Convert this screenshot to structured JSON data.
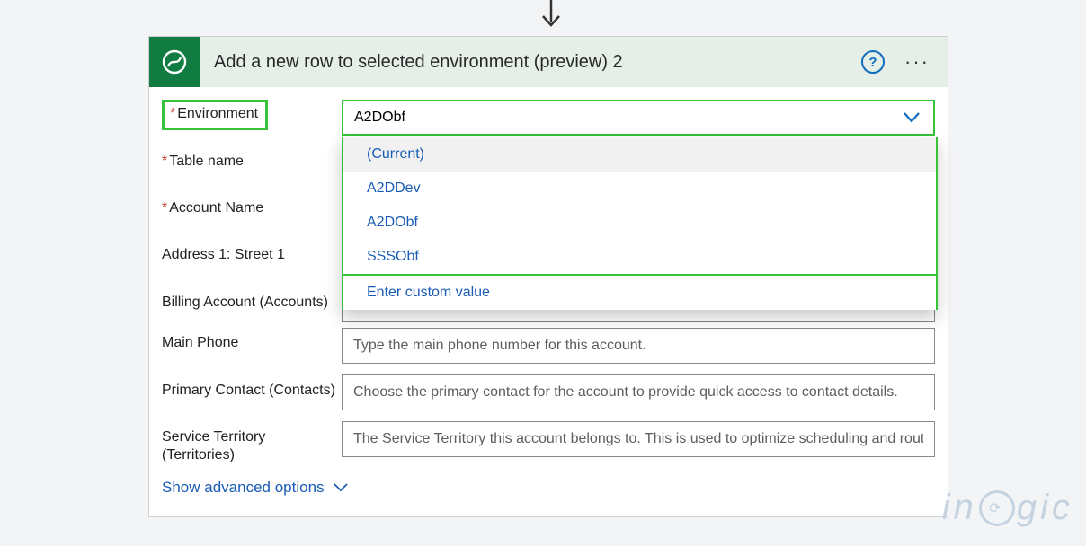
{
  "header": {
    "title": "Add a new row to selected environment (preview) 2",
    "icon": "dataverse-swirl-icon",
    "help": "?",
    "more": "···"
  },
  "fields": {
    "environment": {
      "label": "Environment",
      "value": "A2DObf",
      "required": true
    },
    "table_name": {
      "label": "Table name",
      "required": true
    },
    "account_name": {
      "label": "Account Name",
      "required": true
    },
    "address1_street1": {
      "label": "Address 1: Street 1"
    },
    "billing_account": {
      "label": "Billing Account (Accounts)"
    },
    "main_phone": {
      "label": "Main Phone",
      "placeholder": "Type the main phone number for this account."
    },
    "primary_contact": {
      "label": "Primary Contact (Contacts)",
      "placeholder": "Choose the primary contact for the account to provide quick access to contact details."
    },
    "service_territory": {
      "label": "Service Territory (Territories)",
      "placeholder": "The Service Territory this account belongs to. This is used to optimize scheduling and routing."
    }
  },
  "dropdown": {
    "options": [
      {
        "label": "(Current)",
        "selected": true
      },
      {
        "label": "A2DDev"
      },
      {
        "label": "A2DObf"
      },
      {
        "label": "SSSObf"
      }
    ],
    "custom_value_label": "Enter custom value"
  },
  "advanced_options_label": "Show advanced options",
  "watermark": {
    "prefix": "in",
    "suffix": "gic",
    "inner": "⟳"
  }
}
